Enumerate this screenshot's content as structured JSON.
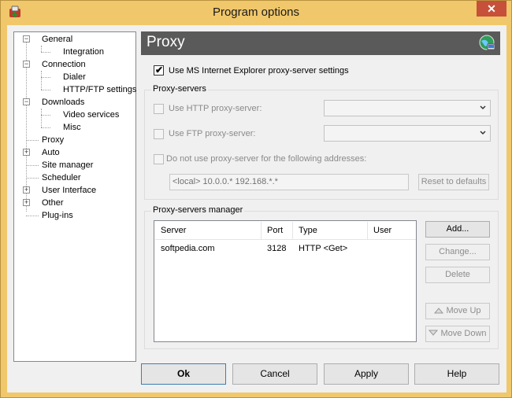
{
  "window": {
    "title": "Program options",
    "close_label": "✕"
  },
  "tree": {
    "items": [
      {
        "label": "General"
      },
      {
        "label": "Integration"
      },
      {
        "label": "Connection"
      },
      {
        "label": "Dialer"
      },
      {
        "label": "HTTP/FTP settings"
      },
      {
        "label": "Downloads"
      },
      {
        "label": "Video services"
      },
      {
        "label": "Misc"
      },
      {
        "label": "Proxy"
      },
      {
        "label": "Auto"
      },
      {
        "label": "Site manager"
      },
      {
        "label": "Scheduler"
      },
      {
        "label": "User Interface"
      },
      {
        "label": "Other"
      },
      {
        "label": "Plug-ins"
      }
    ]
  },
  "panel": {
    "title": "Proxy"
  },
  "ie_checkbox": {
    "label": "Use MS Internet Explorer proxy-server settings",
    "checked": true
  },
  "proxy_servers": {
    "title": "Proxy-servers",
    "http_label": "Use HTTP proxy-server:",
    "ftp_label": "Use FTP proxy-server:",
    "bypass_label": "Do not use proxy-server for the following addresses:",
    "bypass_value": "<local> 10.0.0.* 192.168.*.*",
    "reset_label": "Reset to defaults"
  },
  "manager": {
    "title": "Proxy-servers manager",
    "columns": [
      "Server",
      "Port",
      "Type",
      "User"
    ],
    "rows": [
      [
        "softpedia.com",
        "3128",
        "HTTP <Get>",
        ""
      ]
    ],
    "add_label": "Add...",
    "change_label": "Change...",
    "delete_label": "Delete",
    "move_up_label": "Move Up",
    "move_down_label": "Move Down"
  },
  "footer": {
    "ok": "Ok",
    "cancel": "Cancel",
    "apply": "Apply",
    "help": "Help"
  }
}
